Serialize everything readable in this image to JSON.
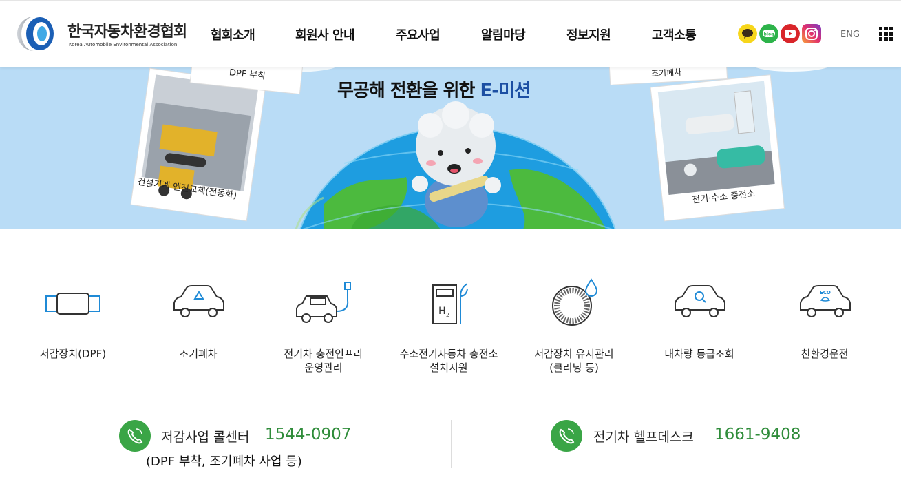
{
  "header": {
    "logo_title": "한국자동차환경협회",
    "logo_sub": "Korea Automobile Environmental Association",
    "nav": [
      "협회소개",
      "회원사 안내",
      "주요사업",
      "알림마당",
      "정보지원",
      "고객소통"
    ],
    "social": [
      {
        "name": "kakao",
        "color": "#f7d61b",
        "label": "kakao-icon"
      },
      {
        "name": "blog",
        "color": "#2db34a",
        "text": "blog",
        "label": "blog-icon"
      },
      {
        "name": "youtube",
        "color": "#d9252a",
        "label": "youtube-icon"
      },
      {
        "name": "instagram",
        "color": "#c13584",
        "label": "instagram-icon"
      }
    ],
    "lang": "ENG"
  },
  "hero": {
    "title_main": "무공해 전환을 위한 ",
    "title_accent": "E-미션",
    "card_left_caption": "건설기계 엔진교체(전동화)",
    "card_top_left_caption": "DPF 부착",
    "card_top_right_caption": "조기폐차",
    "card_right_caption": "전기·수소 충전소"
  },
  "services": [
    {
      "label": "저감장치(DPF)"
    },
    {
      "label": "조기폐차"
    },
    {
      "label": "전기차 충전인프라\n운영관리"
    },
    {
      "label": "수소전기자동차 충전소\n설치지원"
    },
    {
      "label": "저감장치 유지관리\n(클리닝 등)"
    },
    {
      "label": "내차량 등급조회"
    },
    {
      "label": "친환경운전"
    }
  ],
  "contacts": [
    {
      "label": "저감사업 콜센터",
      "number": "1544-0907",
      "note": "(DPF 부착, 조기폐차 사업 등)"
    },
    {
      "label": "전기차 헬프데스크",
      "number": "1661-9408"
    }
  ],
  "colors": {
    "accent_green": "#3aa546",
    "number_green": "#2f8c3a",
    "icon_blue": "#1f8ad6",
    "hero_bg": "#b9dcf6"
  }
}
